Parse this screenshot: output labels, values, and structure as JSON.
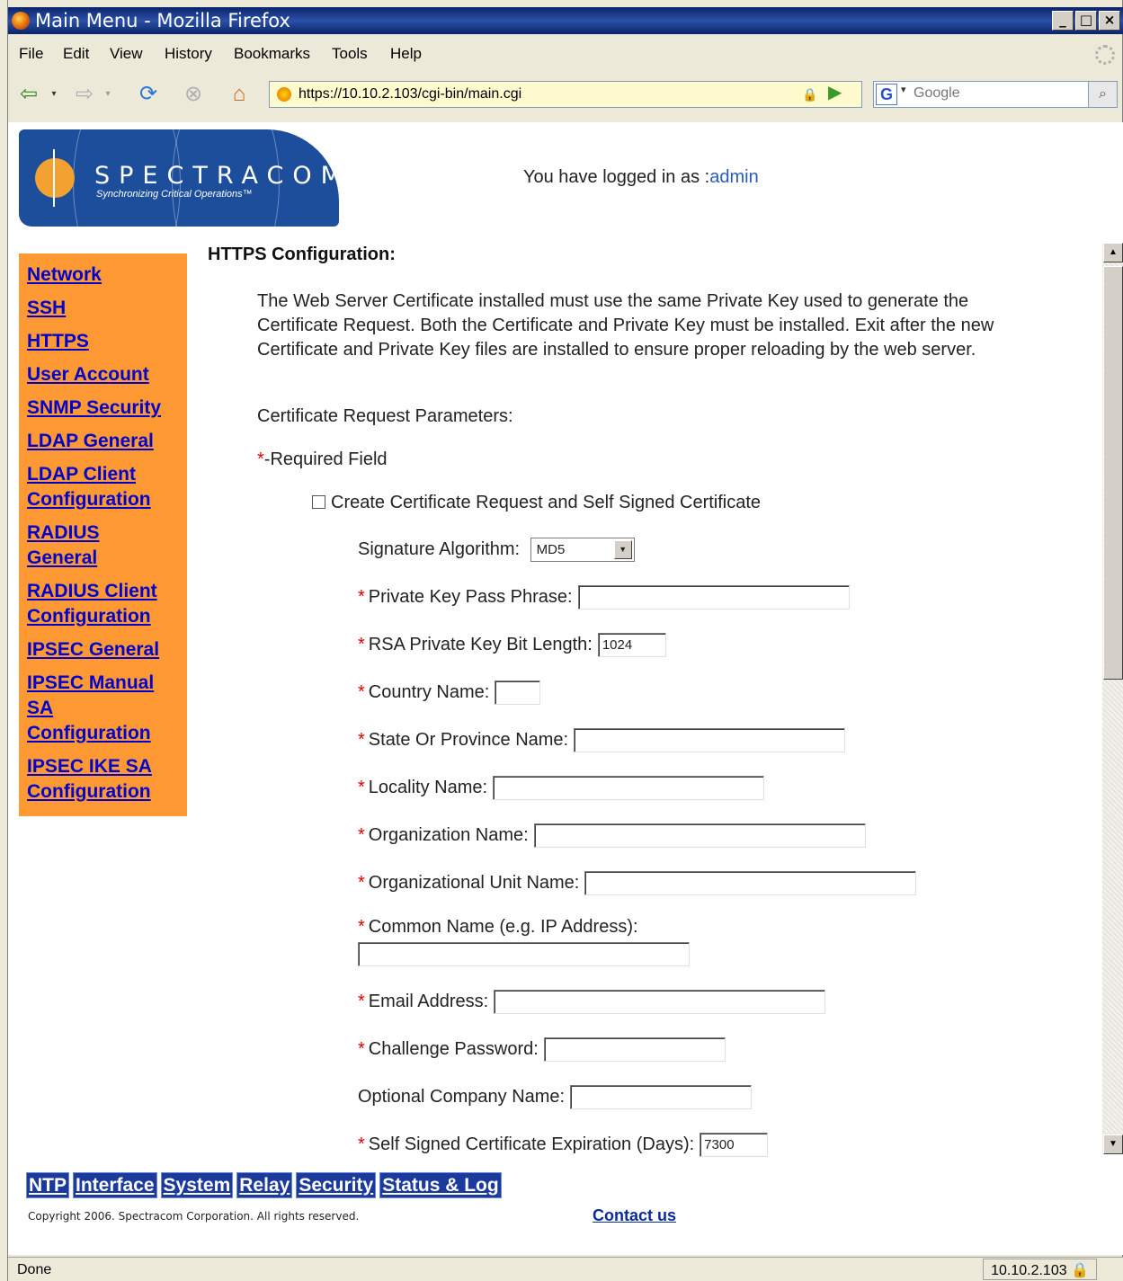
{
  "window": {
    "title": "Main Menu - Mozilla Firefox"
  },
  "menu": [
    "File",
    "Edit",
    "View",
    "History",
    "Bookmarks",
    "Tools",
    "Help"
  ],
  "navigation": {
    "url": "https://10.10.2.103/cgi-bin/main.cgi",
    "search_placeholder": "Google"
  },
  "header": {
    "logo_name": "SPECTRACOM",
    "logo_tagline": "Synchronizing Critical Operations™",
    "logged_in_prefix": "You have logged in as :",
    "user": "admin"
  },
  "sidebar": {
    "items": [
      "Network",
      "SSH",
      "HTTPS",
      "User Account",
      "SNMP Security",
      "LDAP General",
      "LDAP Client Configuration",
      "RADIUS General",
      "RADIUS Client Configuration",
      "IPSEC General",
      "IPSEC Manual SA Configuration",
      "IPSEC IKE SA Configuration"
    ]
  },
  "main": {
    "heading": "HTTPS Configuration:",
    "description": "The Web Server Certificate installed must use the same Private Key used to generate the Certificate Request. Both the Certificate and Private Key must be installed. Exit after the new Certificate and Private Key files are installed to ensure proper reloading by the web server.",
    "params_label": "Certificate Request Parameters:",
    "required_mark": "*",
    "required_text": "-Required Field",
    "checkbox_label": "Create Certificate Request and Self Signed Certificate",
    "signature_label": "Signature Algorithm:",
    "signature_value": "MD5",
    "fields": {
      "passphrase": {
        "label": "Private Key Pass Phrase:",
        "value": ""
      },
      "bitlength": {
        "label": "RSA Private Key Bit Length:",
        "value": "1024"
      },
      "country": {
        "label": "Country Name:",
        "value": ""
      },
      "state": {
        "label": "State Or Province Name:",
        "value": ""
      },
      "locality": {
        "label": "Locality Name:",
        "value": ""
      },
      "org": {
        "label": "Organization Name:",
        "value": ""
      },
      "orgunit": {
        "label": "Organizational Unit Name:",
        "value": ""
      },
      "common": {
        "label": "Common Name (e.g. IP Address):",
        "value": ""
      },
      "email": {
        "label": "Email Address:",
        "value": ""
      },
      "challenge": {
        "label": "Challenge Password:",
        "value": ""
      },
      "company": {
        "label": "Optional Company Name:",
        "value": ""
      },
      "expiration": {
        "label": "Self Signed Certificate Expiration (Days):",
        "value": "7300"
      }
    }
  },
  "bottom_nav": [
    "NTP",
    "Interface",
    "System",
    "Relay",
    "Security",
    "Status & Log"
  ],
  "footer": {
    "copyright": "Copyright 2006. Spectracom Corporation. All rights reserved.",
    "contact": "Contact us"
  },
  "status": {
    "text": "Done",
    "host": "10.10.2.103"
  }
}
